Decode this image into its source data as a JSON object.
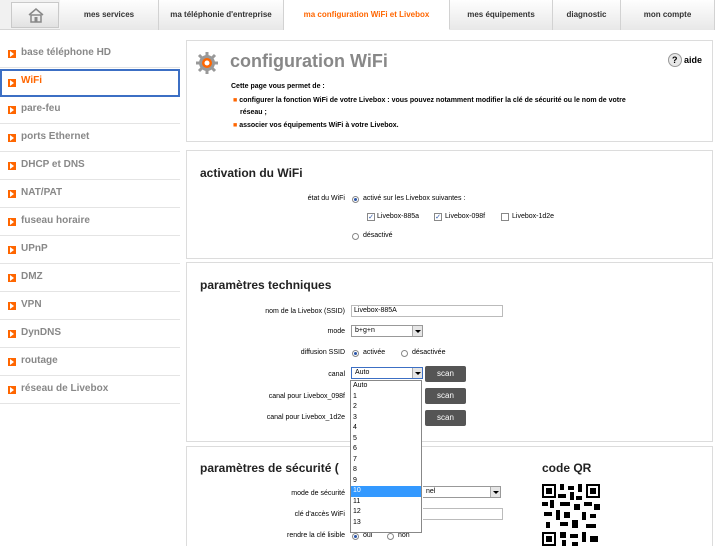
{
  "nav": {
    "tabs": [
      "mes services",
      "ma téléphonie d'entreprise",
      "ma configuration WiFi et Livebox",
      "mes équipements",
      "diagnostic",
      "mon compte"
    ],
    "active": 2
  },
  "sidebar": {
    "items": [
      "base téléphone HD",
      "WiFi",
      "pare-feu",
      "ports Ethernet",
      "DHCP et DNS",
      "NAT/PAT",
      "fuseau horaire",
      "UPnP",
      "DMZ",
      "VPN",
      "DynDNS",
      "routage",
      "réseau de Livebox"
    ],
    "selected": 1
  },
  "header": {
    "title": "configuration WiFi",
    "help": "aide",
    "intro": "Cette page vous permet de :",
    "bullet1a": "configurer la fonction WiFi de votre Livebox : vous pouvez notamment modifier la clé de sécurité ou le nom de votre",
    "bullet1b": "réseau ;",
    "bullet2": "associer vos équipements WiFi à votre Livebox."
  },
  "activation": {
    "title": "activation du WiFi",
    "state_label": "état du WiFi",
    "on_label": "activé sur les Livebox suivantes :",
    "boxes": [
      {
        "label": "Livebox-885a",
        "checked": true
      },
      {
        "label": "Livebox-098f",
        "checked": true
      },
      {
        "label": "Livebox-1d2e",
        "checked": false
      }
    ],
    "off_label": "désactivé"
  },
  "technical": {
    "title": "paramètres techniques",
    "ssid_label": "nom de la Livebox (SSID)",
    "ssid_value": "Livebox-885A",
    "mode_label": "mode",
    "mode_value": "b+g+n",
    "broadcast_label": "diffusion SSID",
    "broadcast_on": "activée",
    "broadcast_off": "désactivée",
    "channel_label": "canal",
    "channel_value": "Auto",
    "channel2_label": "canal pour Livebox_098f",
    "channel3_label": "canal pour Livebox_1d2e",
    "scan": "scan"
  },
  "channel_options": [
    "Auto",
    "1",
    "2",
    "3",
    "4",
    "5",
    "6",
    "7",
    "8",
    "9",
    "10",
    "11",
    "12",
    "13"
  ],
  "channel_highlight": 10,
  "security": {
    "title": "paramètres de sécurité (",
    "mode_label": "mode de sécurité",
    "mode_value_tail": "nel",
    "key_label": "clé d'accès WiFi",
    "readable_label": "rendre la clé lisible",
    "yes": "oui",
    "no": "non"
  },
  "qr": {
    "title": "code QR"
  },
  "colors": {
    "accent": "#ff6600",
    "selection": "#3c6fc4",
    "highlight": "#3399ff"
  }
}
